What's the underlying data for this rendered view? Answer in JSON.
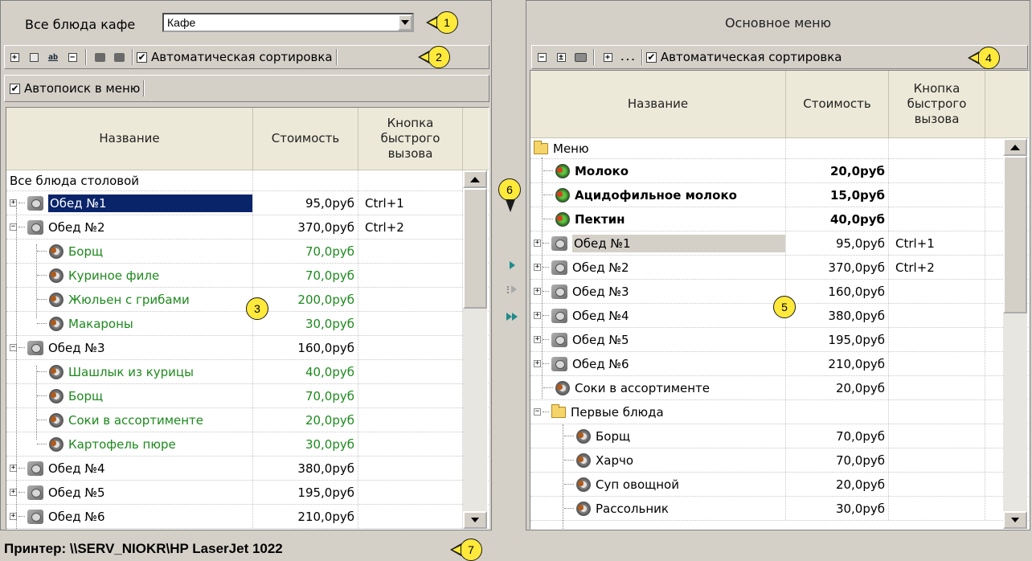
{
  "left": {
    "cafe_label": "Все блюда кафе",
    "cafe_value": "Кафе",
    "autosort_label": "Автоматическая сортировка",
    "autosearch_label": "Автопоиск в меню",
    "columns": [
      "Название",
      "Стоимость",
      "Кнопка быстрого вызова"
    ],
    "root_label": "Все блюда столовой",
    "rows": [
      {
        "name": "Обед №1",
        "price": "95,0руб",
        "key": "Ctrl+1"
      },
      {
        "name": "Обед №2",
        "price": "370,0руб",
        "key": "Ctrl+2"
      },
      {
        "name": "Борщ",
        "price": "70,0руб",
        "key": ""
      },
      {
        "name": "Куриное филе",
        "price": "70,0руб",
        "key": ""
      },
      {
        "name": "Жюльен с грибами",
        "price": "200,0руб",
        "key": ""
      },
      {
        "name": "Макароны",
        "price": "30,0руб",
        "key": ""
      },
      {
        "name": "Обед №3",
        "price": "160,0руб",
        "key": ""
      },
      {
        "name": "Шашлык из курицы",
        "price": "40,0руб",
        "key": ""
      },
      {
        "name": "Борщ",
        "price": "70,0руб",
        "key": ""
      },
      {
        "name": "Соки в ассортименте",
        "price": "20,0руб",
        "key": ""
      },
      {
        "name": "Картофель пюре",
        "price": "30,0руб",
        "key": ""
      },
      {
        "name": "Обед №4",
        "price": "380,0руб",
        "key": ""
      },
      {
        "name": "Обед №5",
        "price": "195,0руб",
        "key": ""
      },
      {
        "name": "Обед №6",
        "price": "210,0руб",
        "key": ""
      }
    ]
  },
  "right": {
    "title": "Основное меню",
    "autosort_label": "Автоматическая сортировка",
    "toolbar_ellipsis": "...",
    "columns": [
      "Название",
      "Стоимость",
      "Кнопка быстрого вызова"
    ],
    "rows": [
      {
        "name": "Меню",
        "price": "",
        "key": ""
      },
      {
        "name": "Молоко",
        "price": "20,0руб",
        "key": ""
      },
      {
        "name": "Ацидофильное молоко",
        "price": "15,0руб",
        "key": ""
      },
      {
        "name": "Пектин",
        "price": "40,0руб",
        "key": ""
      },
      {
        "name": "Обед №1",
        "price": "95,0руб",
        "key": "Ctrl+1"
      },
      {
        "name": "Обед №2",
        "price": "370,0руб",
        "key": "Ctrl+2"
      },
      {
        "name": "Обед №3",
        "price": "160,0руб",
        "key": ""
      },
      {
        "name": "Обед №4",
        "price": "380,0руб",
        "key": ""
      },
      {
        "name": "Обед №5",
        "price": "195,0руб",
        "key": ""
      },
      {
        "name": "Обед №6",
        "price": "210,0руб",
        "key": ""
      },
      {
        "name": "Соки в ассортименте",
        "price": "20,0руб",
        "key": ""
      },
      {
        "name": "Первые блюда",
        "price": "",
        "key": ""
      },
      {
        "name": "Борщ",
        "price": "70,0руб",
        "key": ""
      },
      {
        "name": "Харчо",
        "price": "70,0руб",
        "key": ""
      },
      {
        "name": "Суп овощной",
        "price": "20,0руб",
        "key": ""
      },
      {
        "name": "Рассольник",
        "price": "30,0руб",
        "key": ""
      }
    ]
  },
  "status": {
    "printer": "Принтер: \\\\SERV_NIOKR\\HP LaserJet 1022"
  },
  "callouts": [
    "1",
    "2",
    "3",
    "4",
    "5",
    "6",
    "7"
  ],
  "check_mark": "✔",
  "colors": {
    "selected_row": "#0a246a",
    "highlight_row": "#d4d0c8",
    "green_text": "#1d8a1d",
    "callout_fill": "#ffe93b"
  }
}
